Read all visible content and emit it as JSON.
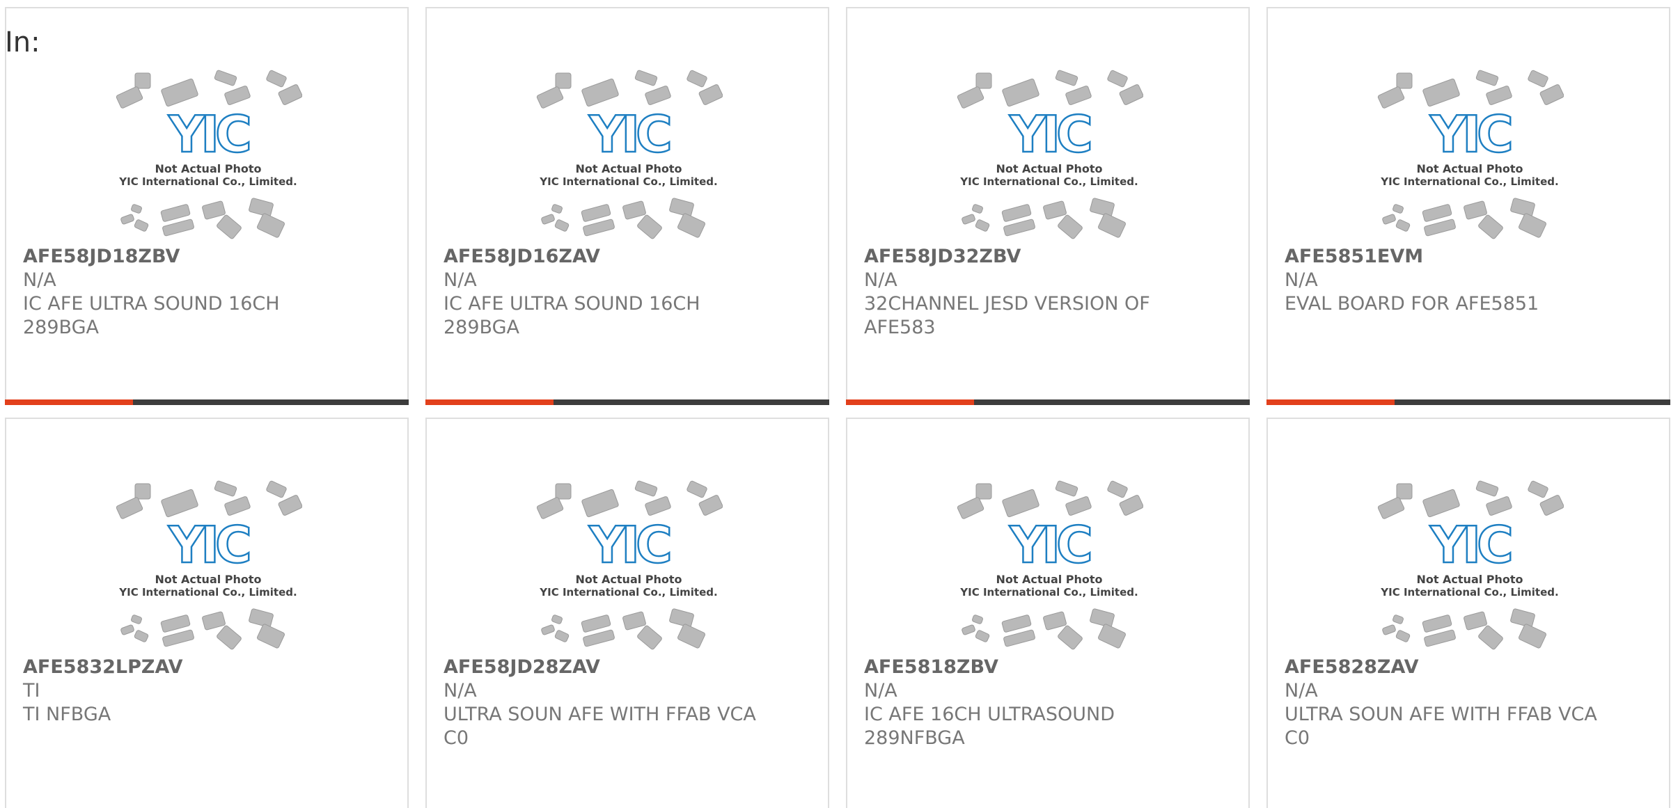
{
  "header": {
    "in_label": "In:"
  },
  "placeholder_photo": {
    "caption_line1": "Not Actual Photo",
    "caption_line2": "YIC International Co., Limited.",
    "logo_text": "YIC",
    "logo_color": "#1e7fc2",
    "chip_color": "#b9b9b9"
  },
  "colors": {
    "accent": "#e2401c",
    "bar": "#3d3d3d",
    "border": "#dedede",
    "text": "#777777"
  },
  "products": [
    {
      "part_number": "AFE58JD18ZBV",
      "manufacturer": "N/A",
      "description": "IC AFE ULTRA SOUND 16CH 289BGA"
    },
    {
      "part_number": "AFE58JD16ZAV",
      "manufacturer": "N/A",
      "description": "IC AFE ULTRA SOUND 16CH 289BGA"
    },
    {
      "part_number": "AFE58JD32ZBV",
      "manufacturer": "N/A",
      "description": "32CHANNEL JESD VERSION OF AFE583"
    },
    {
      "part_number": "AFE5851EVM",
      "manufacturer": "N/A",
      "description": "EVAL BOARD FOR AFE5851"
    },
    {
      "part_number": "AFE5832LPZAV",
      "manufacturer": "TI",
      "description": "TI NFBGA"
    },
    {
      "part_number": "AFE58JD28ZAV",
      "manufacturer": "N/A",
      "description": "ULTRA SOUN AFE WITH FFAB VCA C0"
    },
    {
      "part_number": "AFE5818ZBV",
      "manufacturer": "N/A",
      "description": "IC AFE 16CH ULTRASOUND 289NFBGA"
    },
    {
      "part_number": "AFE5828ZAV",
      "manufacturer": "N/A",
      "description": "ULTRA SOUN AFE WITH FFAB VCA C0"
    }
  ]
}
